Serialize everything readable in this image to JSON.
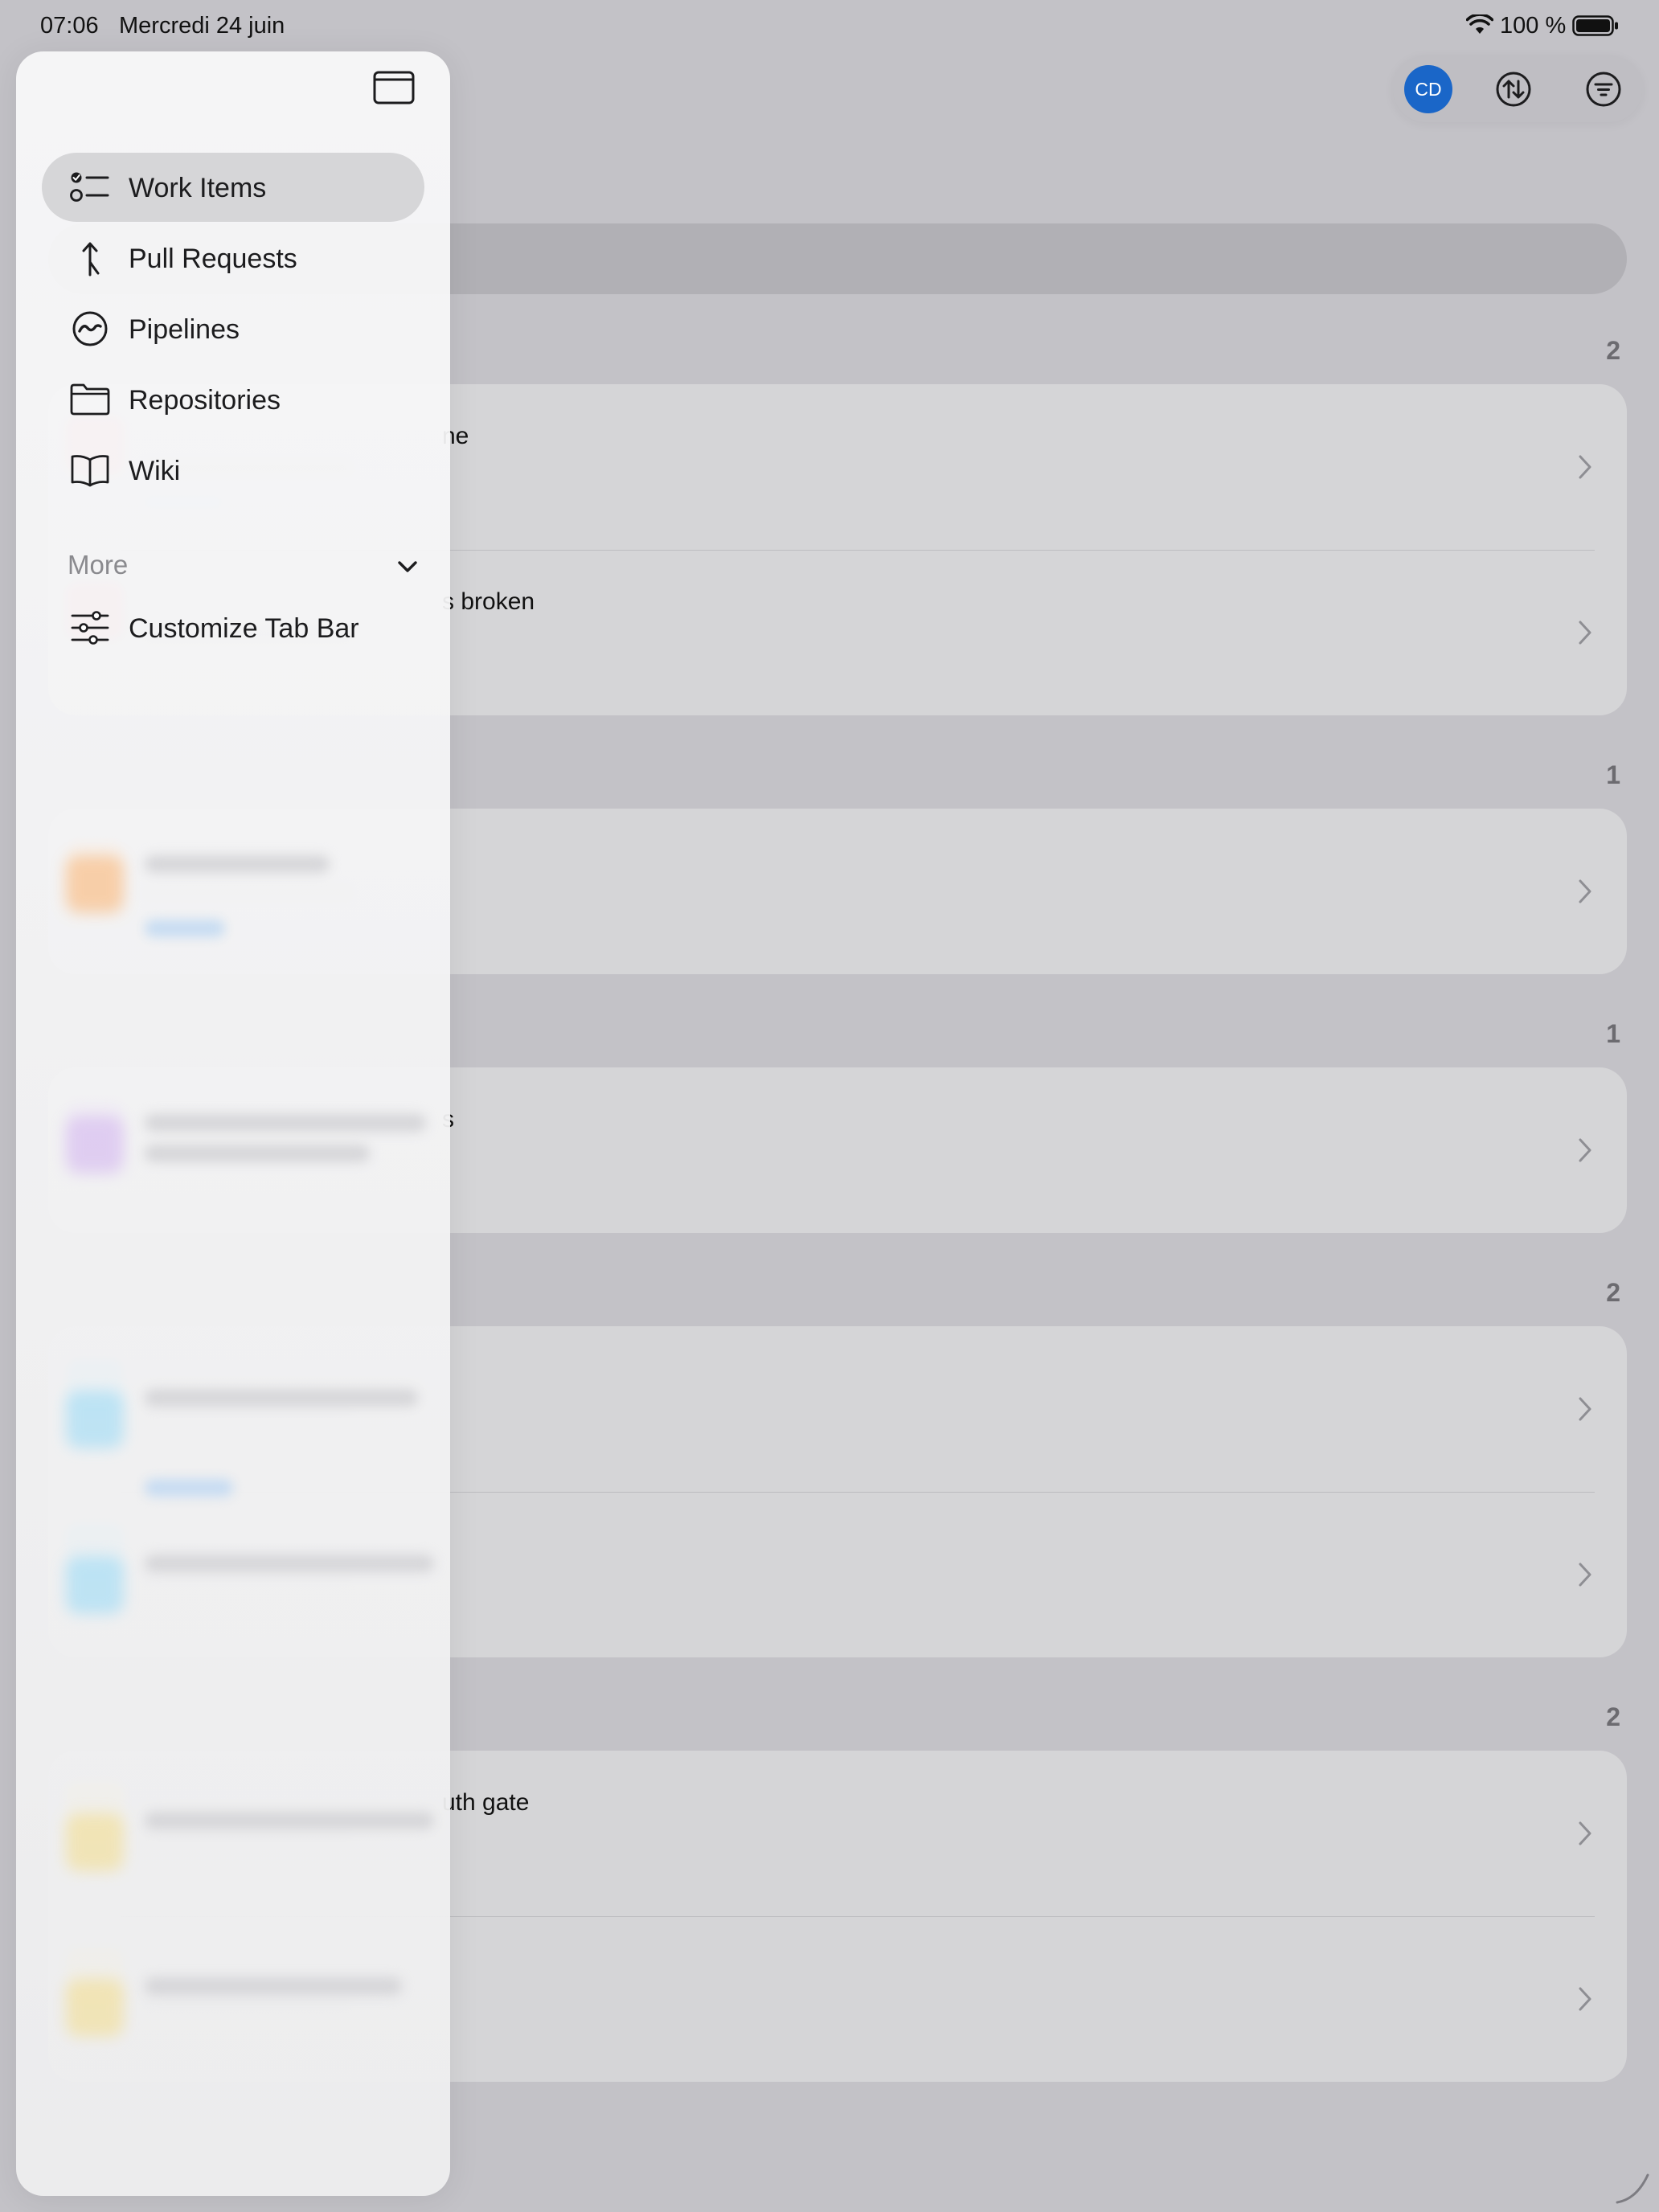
{
  "status_bar": {
    "time": "07:06",
    "date": "Mercredi 24 juin",
    "battery": "100 %"
  },
  "toolbar": {
    "avatar_initials": "CD",
    "avatar_color": "#1a66c8",
    "sort_icon": "sort-arrows-icon",
    "filter_icon": "filter-icon"
  },
  "list": {
    "groups": [
      {
        "count": "2",
        "rows": [
          {
            "title": "ne",
            "icon_color": "#f4a6b0"
          },
          {
            "title": "s broken",
            "icon_color": "#f4a6b0"
          }
        ]
      },
      {
        "count": "1",
        "rows": [
          {
            "title": "",
            "icon_color": "#f9c08b"
          }
        ]
      },
      {
        "count": "1",
        "rows": [
          {
            "title": "s",
            "icon_color": "#c8a6ea"
          }
        ]
      },
      {
        "count": "2",
        "rows": [
          {
            "title": "",
            "icon_color": "#8fd3f2"
          },
          {
            "title": "",
            "icon_color": "#8fd3f2"
          }
        ]
      },
      {
        "count": "2",
        "rows": [
          {
            "title": "uth gate",
            "icon_color": "#f2dc8a"
          },
          {
            "title": "",
            "icon_color": "#f2dc8a"
          }
        ]
      }
    ]
  },
  "sidebar": {
    "toggle_icon": "sidebar-toggle-icon",
    "items": [
      {
        "label": "Work Items",
        "icon": "checklist-icon",
        "selected": true
      },
      {
        "label": "Pull Requests",
        "icon": "branch-merge-icon",
        "selected": false
      },
      {
        "label": "Pipelines",
        "icon": "pipeline-icon",
        "selected": false
      },
      {
        "label": "Repositories",
        "icon": "folder-icon",
        "selected": false
      },
      {
        "label": "Wiki",
        "icon": "book-icon",
        "selected": false
      }
    ],
    "more": {
      "label": "More",
      "items": [
        {
          "label": "Customize Tab Bar",
          "icon": "sliders-icon"
        }
      ]
    }
  }
}
